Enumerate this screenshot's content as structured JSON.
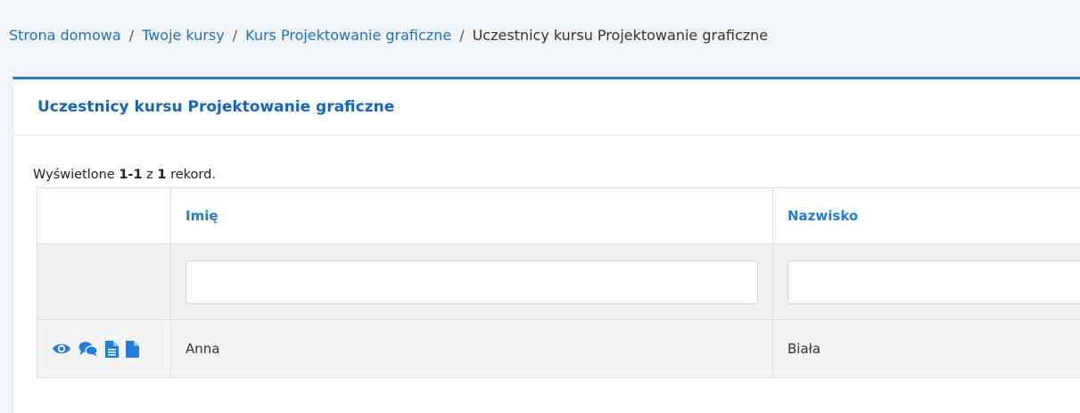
{
  "breadcrumb": {
    "home": "Strona domowa",
    "courses": "Twoje kursy",
    "course": "Kurs Projektowanie graficzne",
    "current": "Uczestnicy kursu Projektowanie graficzne"
  },
  "card": {
    "title": "Uczestnicy kursu Projektowanie graficzne"
  },
  "summary": {
    "prefix": "Wyświetlone",
    "range": "1-1",
    "of": "z",
    "total": "1",
    "suffix": "rekord."
  },
  "table": {
    "columns": [
      "Imię",
      "Nazwisko"
    ],
    "filters": [
      "",
      ""
    ],
    "rows": [
      {
        "first_name": "Anna",
        "last_name": "Biała"
      }
    ],
    "row_actions": [
      "eye-icon",
      "comments-icon",
      "file-text-icon",
      "file-icon"
    ]
  },
  "colors": {
    "accent": "#1e7de0",
    "link": "#1f6fcb",
    "page_bg": "#f3f6f9"
  }
}
